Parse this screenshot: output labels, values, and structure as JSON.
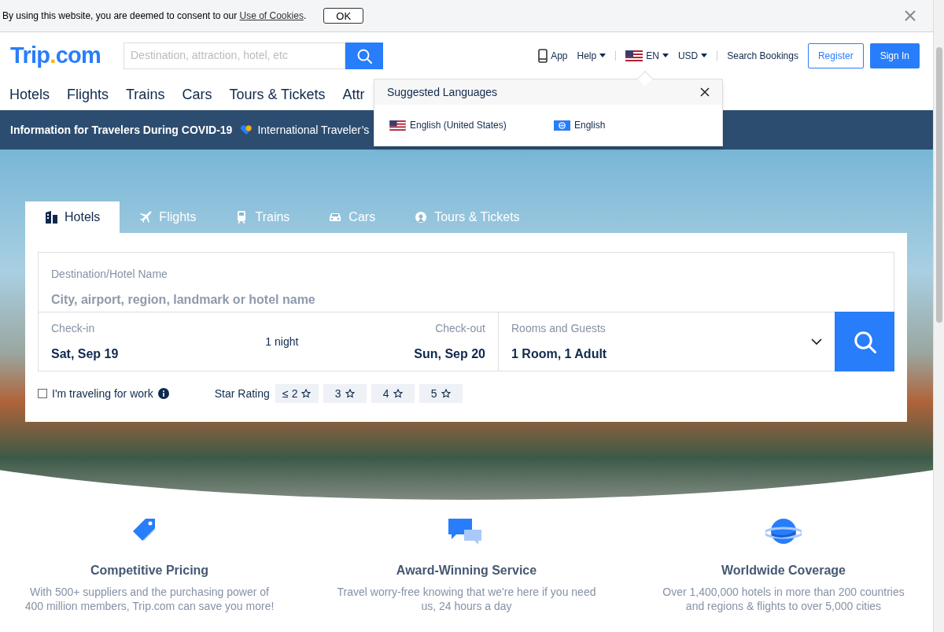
{
  "cookie_bar": {
    "text": "By using this website, you are deemed to consent to our ",
    "link": "Use of Cookies",
    "end": ".",
    "ok_button": "OK"
  },
  "header": {
    "logo": {
      "name": "Trip",
      "dot": ".",
      "suffix": "com"
    },
    "search": {
      "placeholder": "Destination, attraction, hotel, etc"
    },
    "links": [
      {
        "kind": "app",
        "label": "App"
      },
      {
        "kind": "menu",
        "label": "Help"
      },
      {
        "kind": "lang",
        "label": "EN"
      },
      {
        "kind": "menu",
        "label": "USD"
      },
      {
        "kind": "plain",
        "label": "Search Bookings"
      }
    ],
    "register": "Register",
    "sign_in": "Sign In"
  },
  "nav": [
    {
      "label": "Hotels"
    },
    {
      "label": "Flights"
    },
    {
      "label": "Trains"
    },
    {
      "label": "Cars"
    },
    {
      "label": "Tours & Tickets"
    },
    {
      "label": "Attr"
    }
  ],
  "banner": {
    "title": "Information for Travelers During COVID-19",
    "link": "International Traveler’s"
  },
  "language_popup": {
    "title": "Suggested Languages",
    "options": [
      {
        "kind": "us",
        "label": "English (United States)"
      },
      {
        "kind": "globe",
        "label": "English"
      }
    ]
  },
  "search_tabs": [
    {
      "kind": "hotel",
      "label": "Hotels",
      "selected": true
    },
    {
      "kind": "plane",
      "label": "Flights",
      "selected": false
    },
    {
      "kind": "train",
      "label": "Trains",
      "selected": false
    },
    {
      "kind": "car",
      "label": "Cars",
      "selected": false
    },
    {
      "kind": "ticket",
      "label": "Tours & Tickets",
      "selected": false
    }
  ],
  "hotel_search": {
    "destination": {
      "label": "Destination/Hotel Name",
      "placeholder": "City, airport, region, landmark or hotel name"
    },
    "check_in": {
      "label": "Check-in",
      "value": "Sat, Sep 19"
    },
    "nights": "1 night",
    "check_out": {
      "label": "Check-out",
      "value": "Sun, Sep 20"
    },
    "guests": {
      "label": "Rooms and Guests",
      "value": "1 Room, 1 Adult"
    },
    "work_travel": {
      "label": "I'm traveling for work",
      "checked": false
    },
    "star_rating": {
      "label": "Star Rating",
      "options": [
        {
          "label": "≤ 2",
          "selected": false
        },
        {
          "label": "3",
          "selected": false
        },
        {
          "label": "4",
          "selected": false
        },
        {
          "label": "5",
          "selected": false
        }
      ]
    }
  },
  "features": [
    {
      "kind": "tag",
      "title": "Competitive Pricing",
      "text": "With 500+ suppliers and the purchasing power of 400 million members, Trip.com can save you more!"
    },
    {
      "kind": "chat",
      "title": "Award-Winning Service",
      "text": "Travel worry-free knowing that we're here if you need us, 24 hours a day"
    },
    {
      "kind": "planet",
      "title": "Worldwide Coverage",
      "text": "Over 1,400,000 hotels in more than 200 countries and regions & flights to over 5,000 cities"
    }
  ]
}
